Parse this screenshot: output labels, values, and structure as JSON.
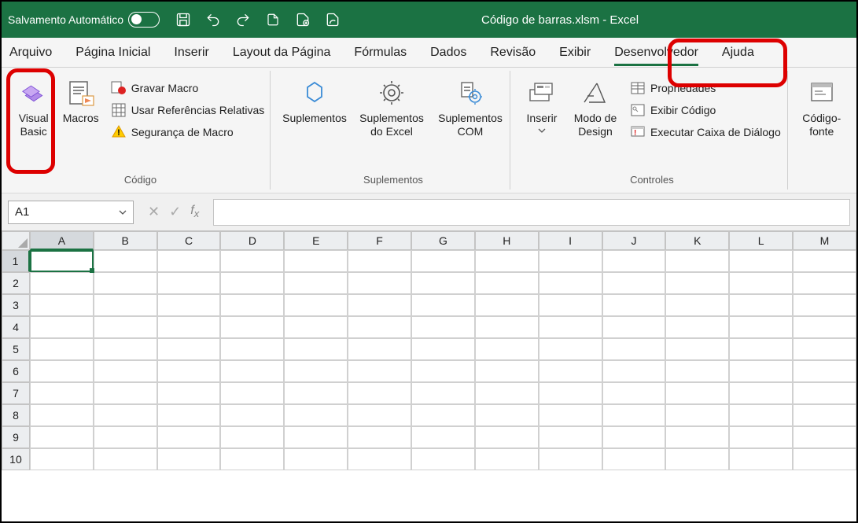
{
  "titlebar": {
    "autosave_label": "Salvamento Automático",
    "title": "Código de barras.xlsm  -  Excel"
  },
  "tabs": {
    "arquivo": "Arquivo",
    "pagina_inicial": "Página Inicial",
    "inserir": "Inserir",
    "layout": "Layout da Página",
    "formulas": "Fórmulas",
    "dados": "Dados",
    "revisao": "Revisão",
    "exibir": "Exibir",
    "desenvolvedor": "Desenvolvedor",
    "ajuda": "Ajuda"
  },
  "ribbon": {
    "codigo": {
      "visual_basic": "Visual\nBasic",
      "macros": "Macros",
      "gravar_macro": "Gravar Macro",
      "usar_ref": "Usar Referências Relativas",
      "seguranca": "Segurança de Macro",
      "label": "Código"
    },
    "suplementos": {
      "suplementos": "Suplementos",
      "suplementos_excel": "Suplementos\ndo Excel",
      "suplementos_com": "Suplementos\nCOM",
      "label": "Suplementos"
    },
    "controles": {
      "inserir": "Inserir",
      "modo_design": "Modo de\nDesign",
      "propriedades": "Propriedades",
      "exibir_codigo": "Exibir Código",
      "executar": "Executar Caixa de Diálogo",
      "label": "Controles"
    },
    "xml": {
      "codigofonte": "Código-\nfonte"
    }
  },
  "formula_bar": {
    "name_box": "A1"
  },
  "grid": {
    "cols": [
      "A",
      "B",
      "C",
      "D",
      "E",
      "F",
      "G",
      "H",
      "I",
      "J",
      "K",
      "L",
      "M"
    ],
    "rows": [
      "1",
      "2",
      "3",
      "4",
      "5",
      "6",
      "7",
      "8",
      "9",
      "10"
    ]
  }
}
